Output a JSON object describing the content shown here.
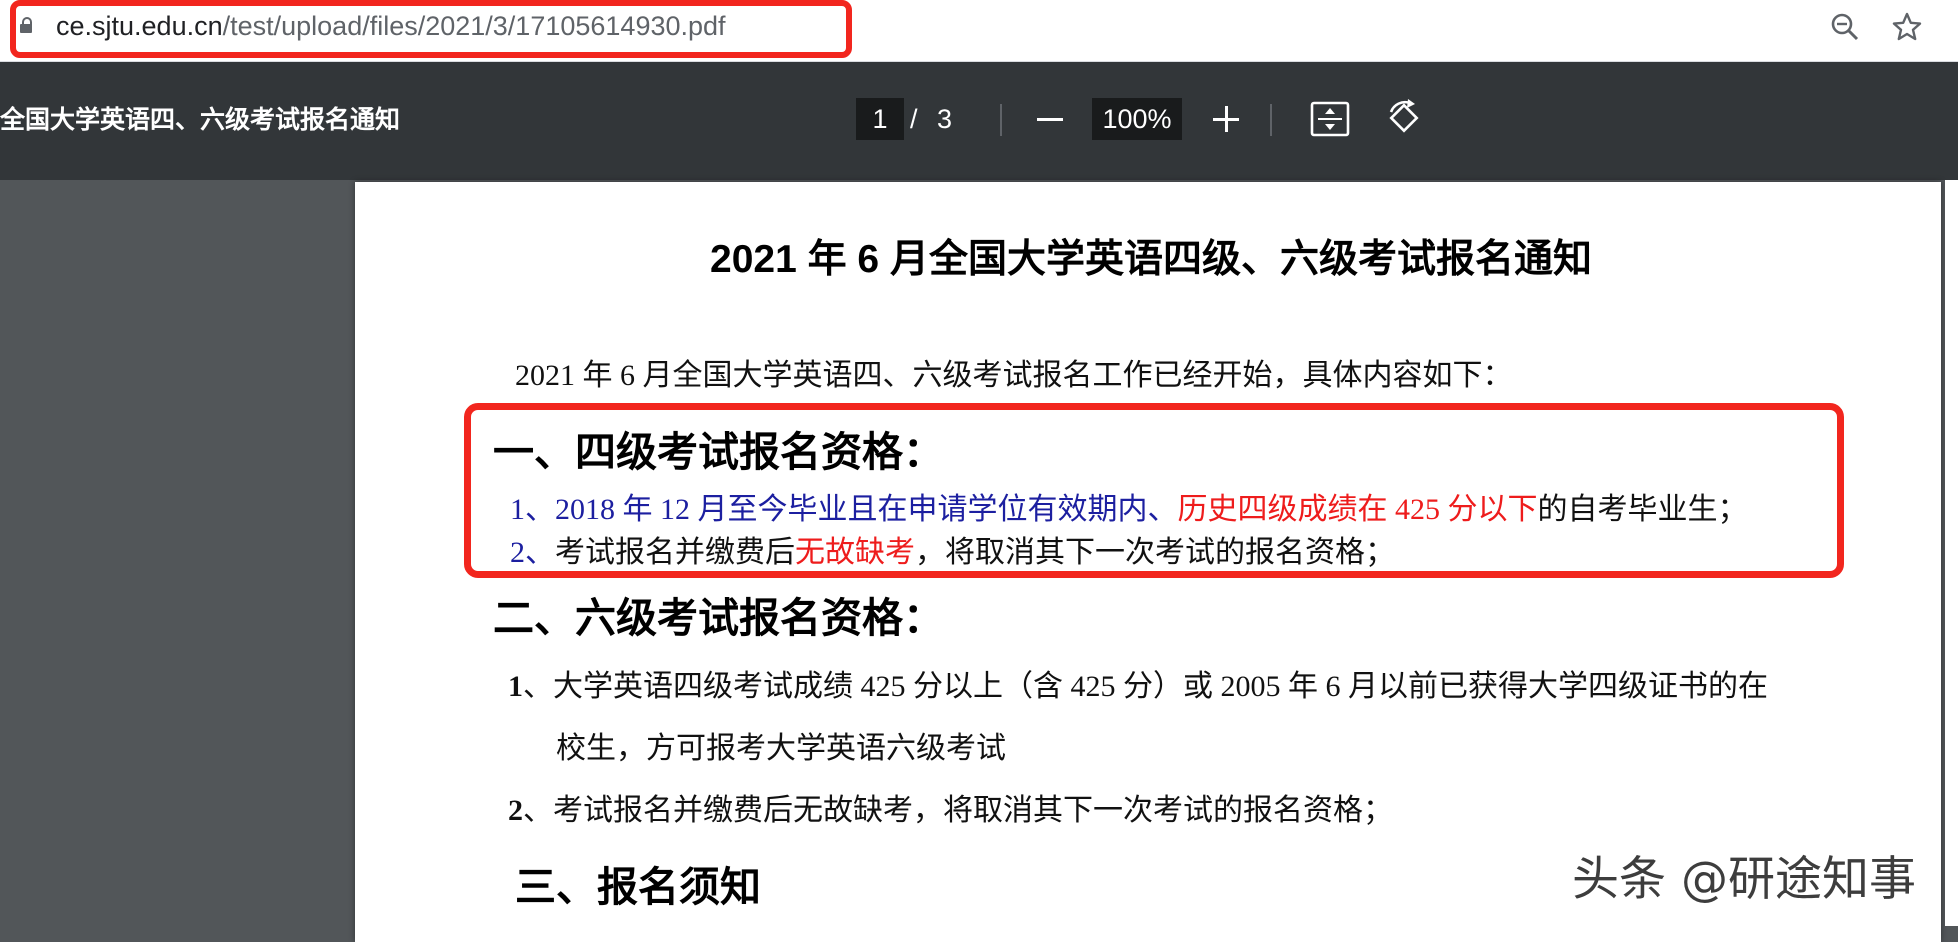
{
  "address_bar": {
    "url_host": "ce.sjtu.edu.cn",
    "url_path": "/test/upload/files/2021/3/17105614930.pdf"
  },
  "toolbar": {
    "title": "全国大学英语四、六级考试报名通知",
    "page_current": "1",
    "page_separator": "/",
    "page_total": "3",
    "zoom": "100%"
  },
  "document": {
    "title": "2021 年 6 月全国大学英语四级、六级考试报名通知",
    "intro": "2021 年 6 月全国大学英语四、六级考试报名工作已经开始，具体内容如下：",
    "section1": {
      "heading": "一、四级考试报名资格：",
      "item1_blue": "1、2018 年 12 月至今毕业且在申请学位有效期内、",
      "item1_red": "历史四级成绩在 425 分以下",
      "item1_black": "的自考毕业生；",
      "item2_blue": "2、",
      "item2_black_a": "考试报名并缴费后",
      "item2_red": "无故缺考",
      "item2_black_b": "，将取消其下一次考试的报名资格；"
    },
    "section2": {
      "heading": "二、六级考试报名资格：",
      "item1_line1_num": "1",
      "item1_line1": "、大学英语四级考试成绩 425 分以上（含 425 分）或 2005 年 6 月以前已获得大学四级证书的在",
      "item1_line2": "校生，方可报考大学英语六级考试",
      "item2_num": "2",
      "item2": "、考试报名并缴费后无故缺考，将取消其下一次考试的报名资格；"
    },
    "section3": {
      "heading": "三、报名须知"
    }
  },
  "watermark": "头条 @研途知事",
  "colors": {
    "highlight": "#f2261e",
    "blue_text": "#1c1fa0",
    "red_text": "#ee1c1c",
    "toolbar_bg": "#323639",
    "viewer_bg": "#525659"
  },
  "icons": [
    "lock-icon",
    "zoom-icon",
    "star-icon",
    "fit-page-icon",
    "rotate-icon"
  ]
}
